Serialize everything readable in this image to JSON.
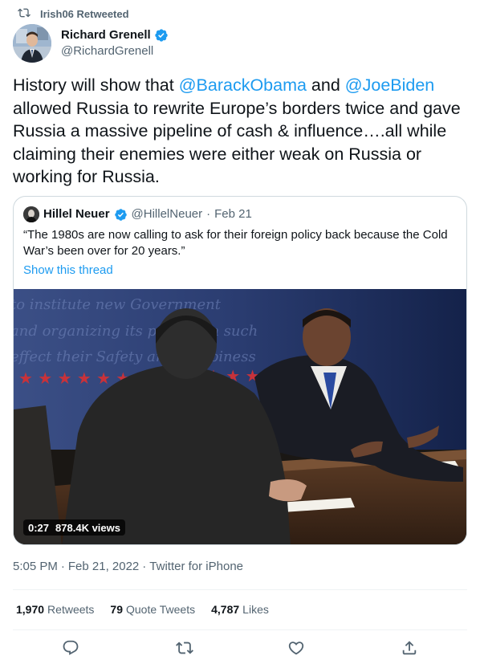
{
  "retweet_context": {
    "label": "Irish06 Retweeted",
    "icon": "retweet-icon"
  },
  "author": {
    "name": "Richard Grenell",
    "handle": "@RichardGrenell",
    "verified": true
  },
  "tweet": {
    "p1": "History will show that ",
    "mention1": "@BarackObama",
    "p2": " and ",
    "mention2": "@JoeBiden",
    "p3": " allowed Russia to rewrite Europe’s borders twice and gave Russia a massive pipeline of cash & influence….all while claiming their enemies were either weak on Russia or working for Russia."
  },
  "quoted": {
    "name": "Hillel Neuer",
    "handle": "@HillelNeuer",
    "separator": "·",
    "date": "Feb 21",
    "text": "“The 1980s are now calling to ask for their foreign policy back because the Cold War’s been over for 20 years.”",
    "thread_link": "Show this thread",
    "video": {
      "duration": "0:27",
      "views": "878.4K views"
    }
  },
  "meta": {
    "time": "5:05 PM",
    "sep1": "·",
    "date": "Feb 21, 2022",
    "sep2": "·",
    "source": "Twitter for iPhone"
  },
  "stats": {
    "retweets_count": "1,970",
    "retweets_label": "Retweets",
    "quotes_count": "79",
    "quotes_label": "Quote Tweets",
    "likes_count": "4,787",
    "likes_label": "Likes"
  },
  "colors": {
    "accent": "#1d9bf0",
    "text": "#0f1419",
    "muted": "#536471",
    "border": "#cfd9de"
  }
}
